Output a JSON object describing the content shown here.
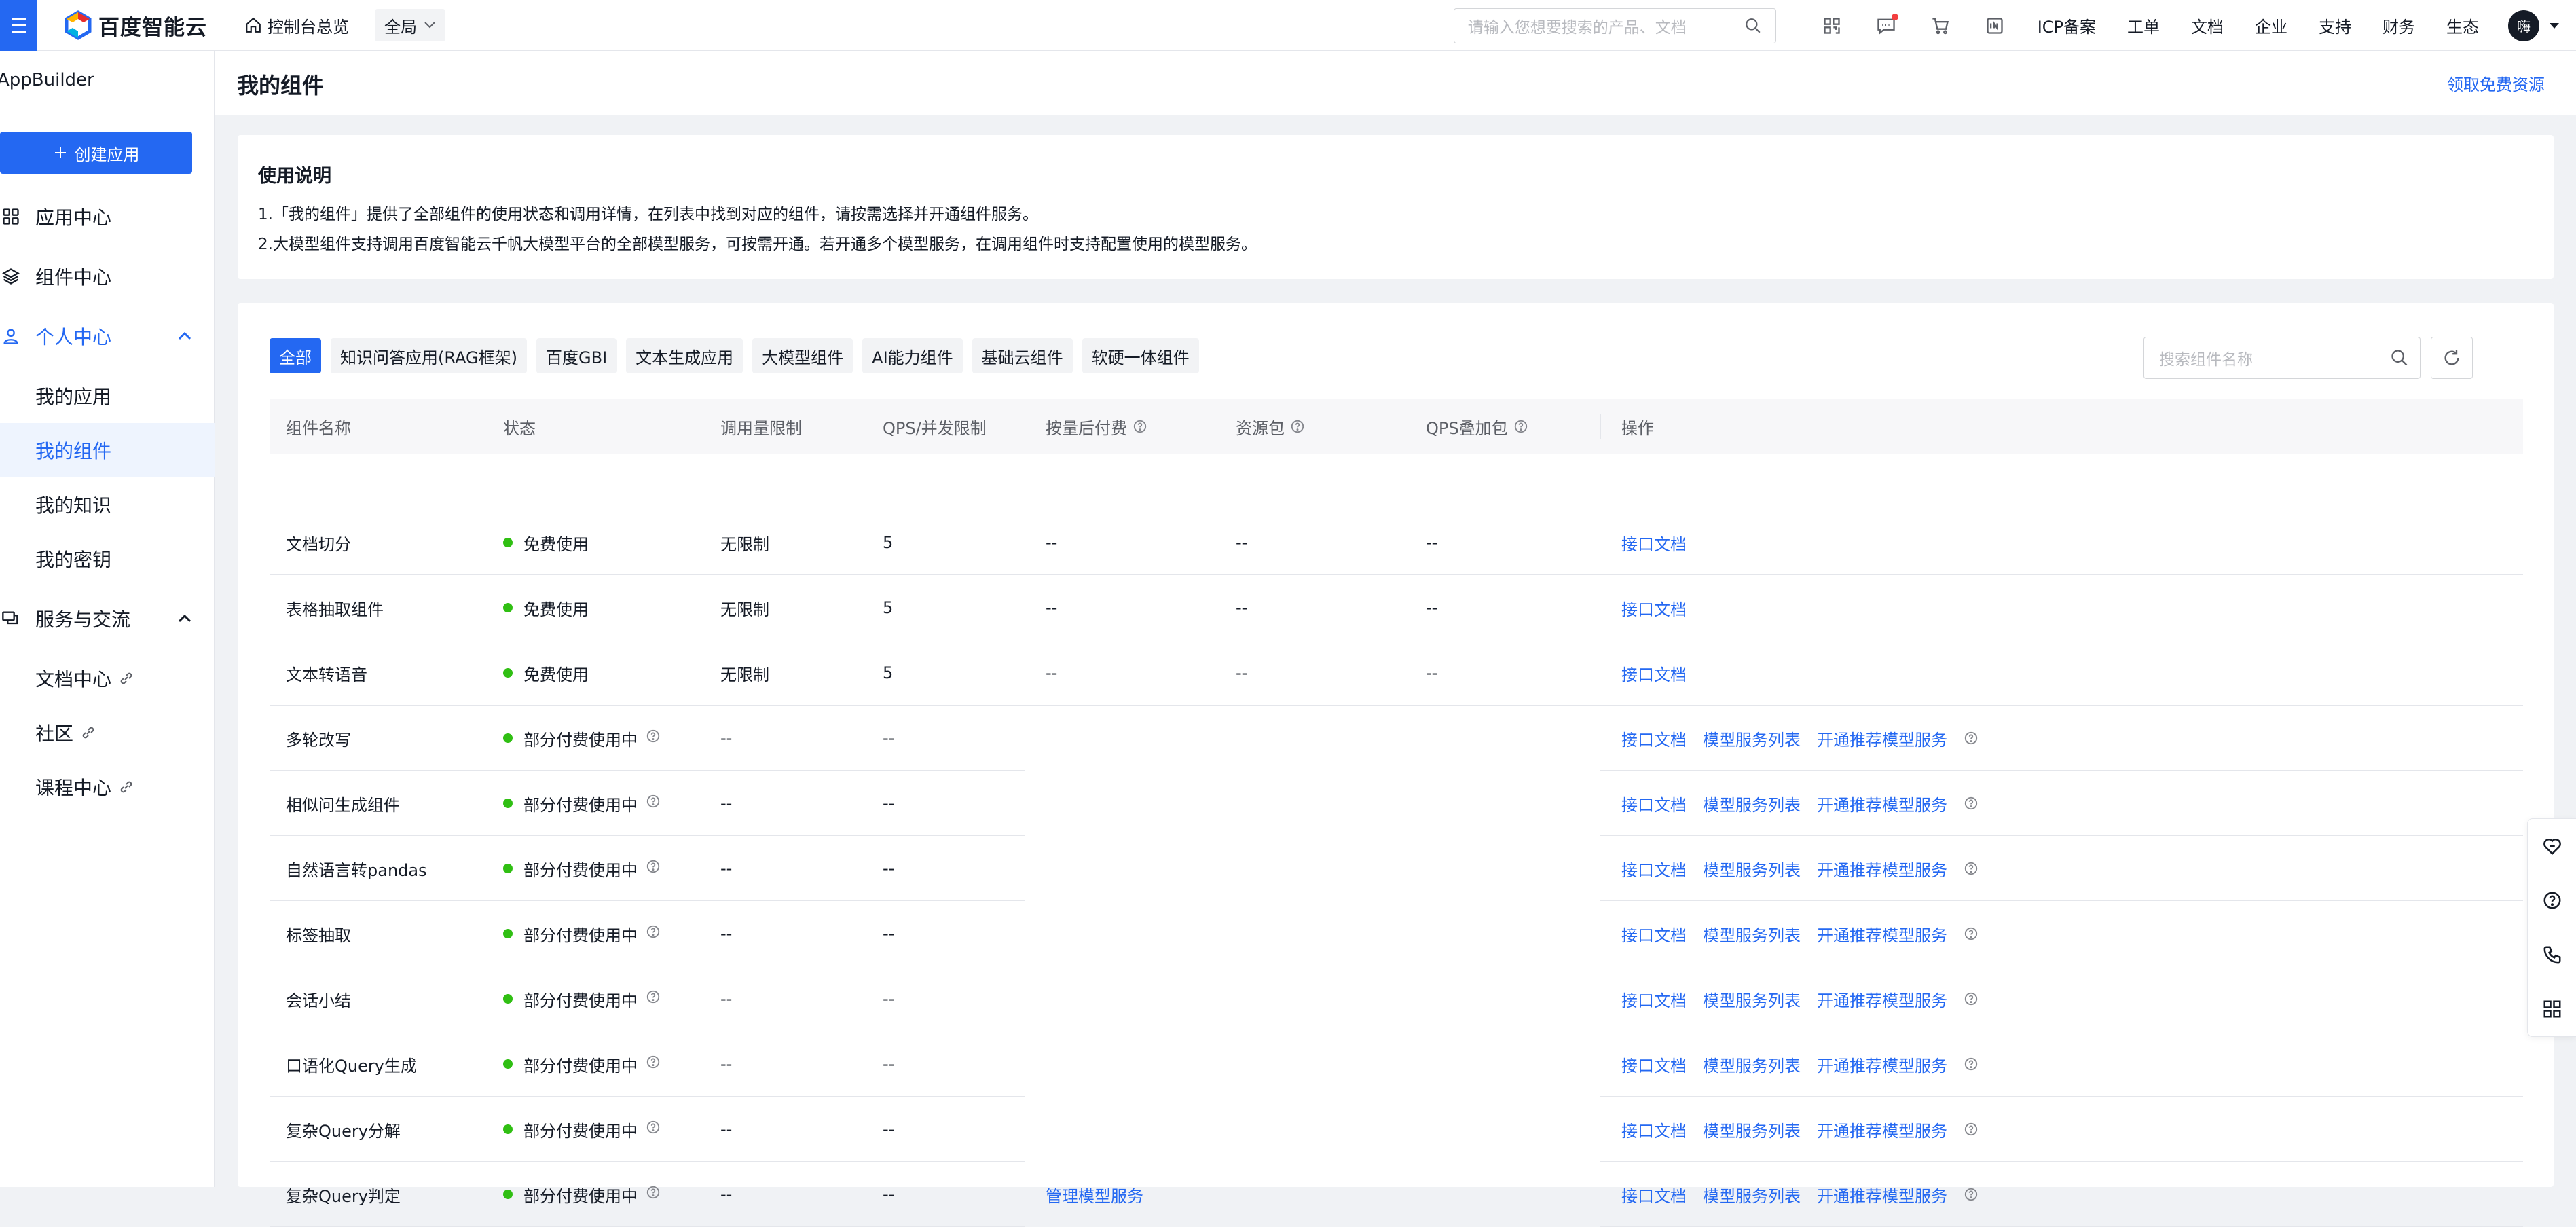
{
  "topbar": {
    "brand": "百度智能云",
    "console_label": "控制台总览",
    "region": "全局",
    "search_placeholder": "请输入您想要搜索的产品、文档",
    "links": [
      "ICP备案",
      "工单",
      "文档",
      "企业",
      "支持",
      "财务",
      "生态"
    ],
    "avatar_text": "嗨"
  },
  "sidebar": {
    "title": "AppBuilder",
    "create_label": "创建应用",
    "items": [
      {
        "label": "应用中心",
        "icon": "grid-icon"
      },
      {
        "label": "组件中心",
        "icon": "layers-icon"
      },
      {
        "label": "个人中心",
        "icon": "user-icon"
      },
      {
        "label": "服务与交流",
        "icon": "chat-icon"
      }
    ],
    "personal_sub": [
      "我的应用",
      "我的组件",
      "我的知识",
      "我的密钥"
    ],
    "service_sub": [
      "文档中心",
      "社区",
      "课程中心"
    ],
    "selected": "我的组件"
  },
  "header": {
    "title": "我的组件",
    "free_link": "领取免费资源"
  },
  "notes": {
    "title": "使用说明",
    "line1": "1.「我的组件」提供了全部组件的使用状态和调用详情，在列表中找到对应的组件，请按需选择并开通组件服务。",
    "line2": "2.大模型组件支持调用百度智能云千帆大模型平台的全部模型服务，可按需开通。若开通多个模型服务，在调用组件时支持配置使用的模型服务。"
  },
  "filters": [
    "全部",
    "知识问答应用(RAG框架)",
    "百度GBI",
    "文本生成应用",
    "大模型组件",
    "AI能力组件",
    "基础云组件",
    "软硬一体组件"
  ],
  "active_filter": "全部",
  "search": {
    "placeholder": "搜索组件名称"
  },
  "table": {
    "headers": [
      "组件名称",
      "状态",
      "调用量限制",
      "QPS/并发限制",
      "按量后付费",
      "资源包",
      "QPS叠加包",
      "操作"
    ],
    "op_labels": {
      "doc": "接口文档",
      "model_list": "模型服务列表",
      "open_model": "开通推荐模型服务",
      "manage": "管理模型服务"
    },
    "rows": [
      {
        "name": "文档切分",
        "status": "免费使用",
        "limit": "无限制",
        "qps": "5",
        "postpay": "--",
        "package": "--",
        "qps_pack": "--",
        "ops": "full_free"
      },
      {
        "name": "表格抽取组件",
        "status": "免费使用",
        "limit": "无限制",
        "qps": "5",
        "postpay": "--",
        "package": "--",
        "qps_pack": "--",
        "ops": "full_free"
      },
      {
        "name": "文本转语音",
        "status": "免费使用",
        "limit": "无限制",
        "qps": "5",
        "postpay": "--",
        "package": "--",
        "qps_pack": "--",
        "ops": "full_free"
      },
      {
        "name": "多轮改写",
        "status": "部分付费使用中",
        "limit": "--",
        "qps": "--"
      },
      {
        "name": "相似问生成组件",
        "status": "部分付费使用中",
        "limit": "--",
        "qps": "--"
      },
      {
        "name": "自然语言转pandas",
        "status": "部分付费使用中",
        "limit": "--",
        "qps": "--"
      },
      {
        "name": "标签抽取",
        "status": "部分付费使用中",
        "limit": "--",
        "qps": "--"
      },
      {
        "name": "会话小结",
        "status": "部分付费使用中",
        "limit": "--",
        "qps": "--"
      },
      {
        "name": "口语化Query生成",
        "status": "部分付费使用中",
        "limit": "--",
        "qps": "--"
      },
      {
        "name": "复杂Query分解",
        "status": "部分付费使用中",
        "limit": "--",
        "qps": "--"
      },
      {
        "name": "复杂Query判定",
        "status": "部分付费使用中",
        "limit": "--",
        "qps": "--"
      }
    ]
  },
  "colors": {
    "primary": "#2468f2",
    "status_green": "#30bf13",
    "border": "#e4e6eb"
  }
}
